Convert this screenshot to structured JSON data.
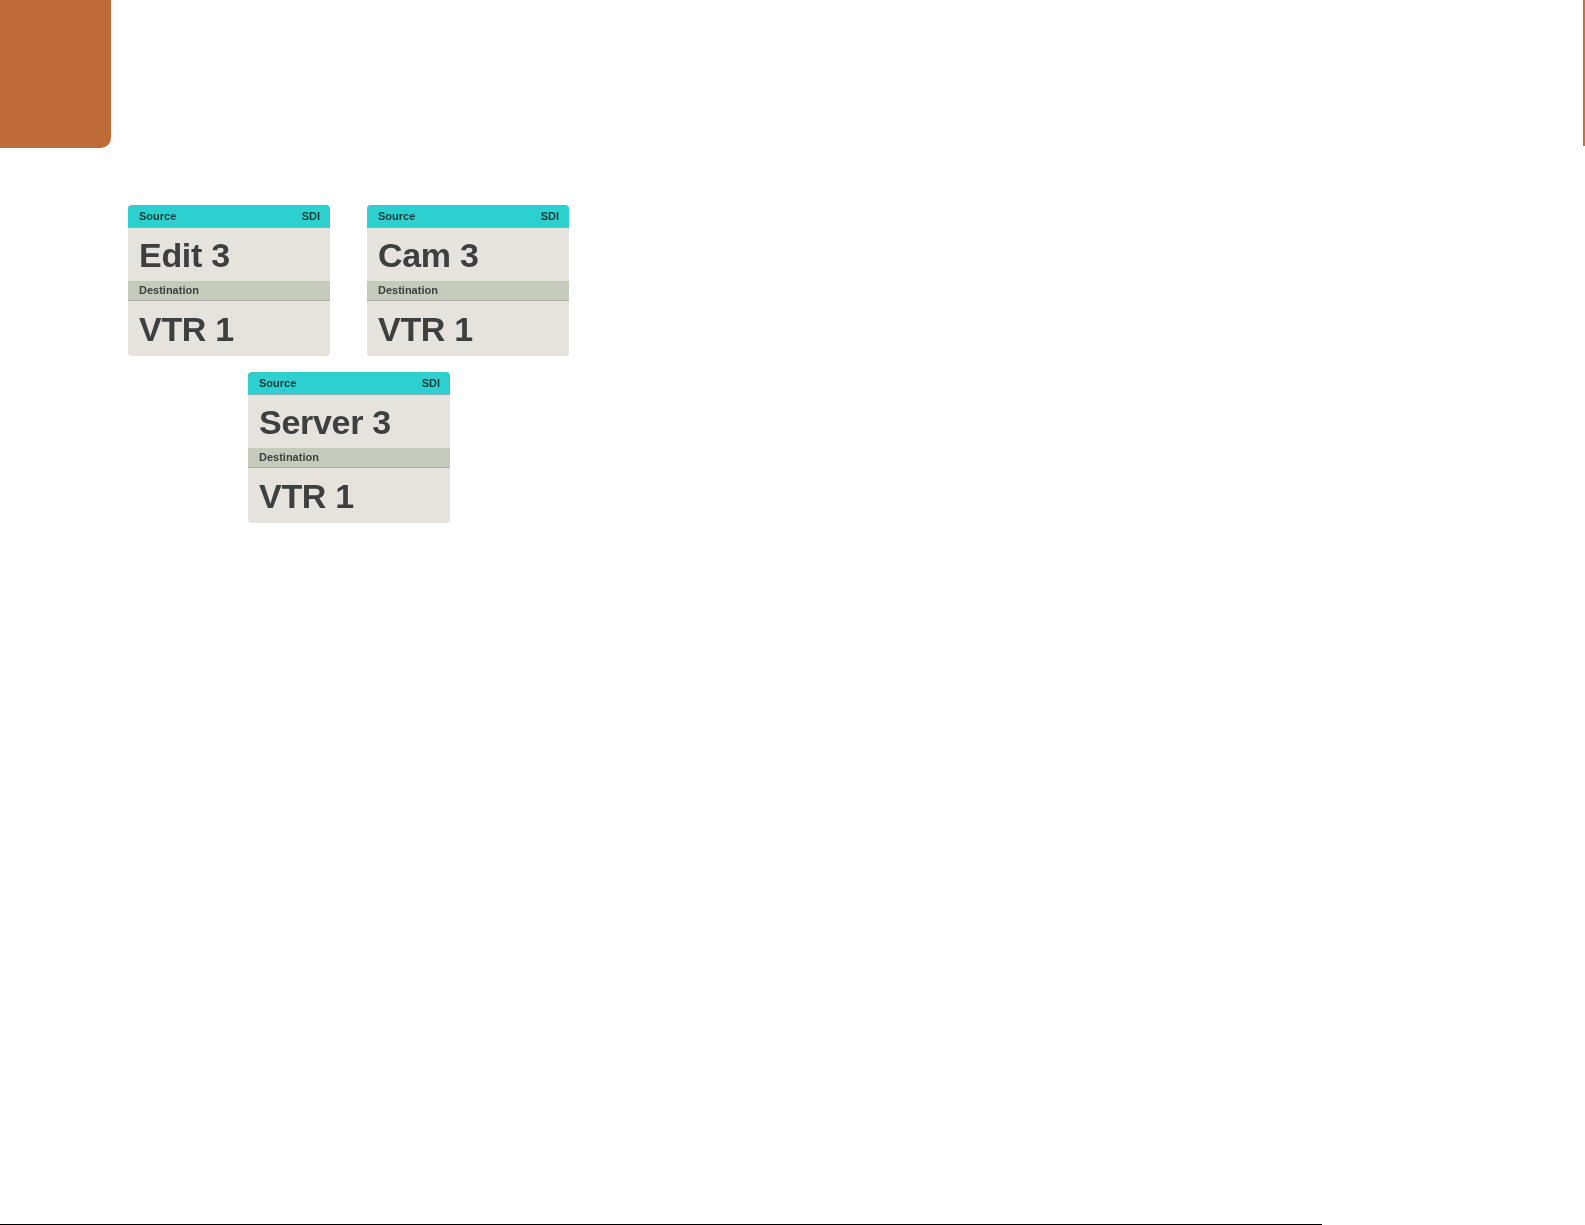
{
  "cards": [
    {
      "source_label": "Source",
      "format": "SDI",
      "source": "Edit 3",
      "destination_label": "Destination",
      "destination": "VTR 1"
    },
    {
      "source_label": "Source",
      "format": "SDI",
      "source": "Cam 3",
      "destination_label": "Destination",
      "destination": "VTR 1"
    },
    {
      "source_label": "Source",
      "format": "SDI",
      "source": "Server 3",
      "destination_label": "Destination",
      "destination": "VTR 1"
    }
  ]
}
